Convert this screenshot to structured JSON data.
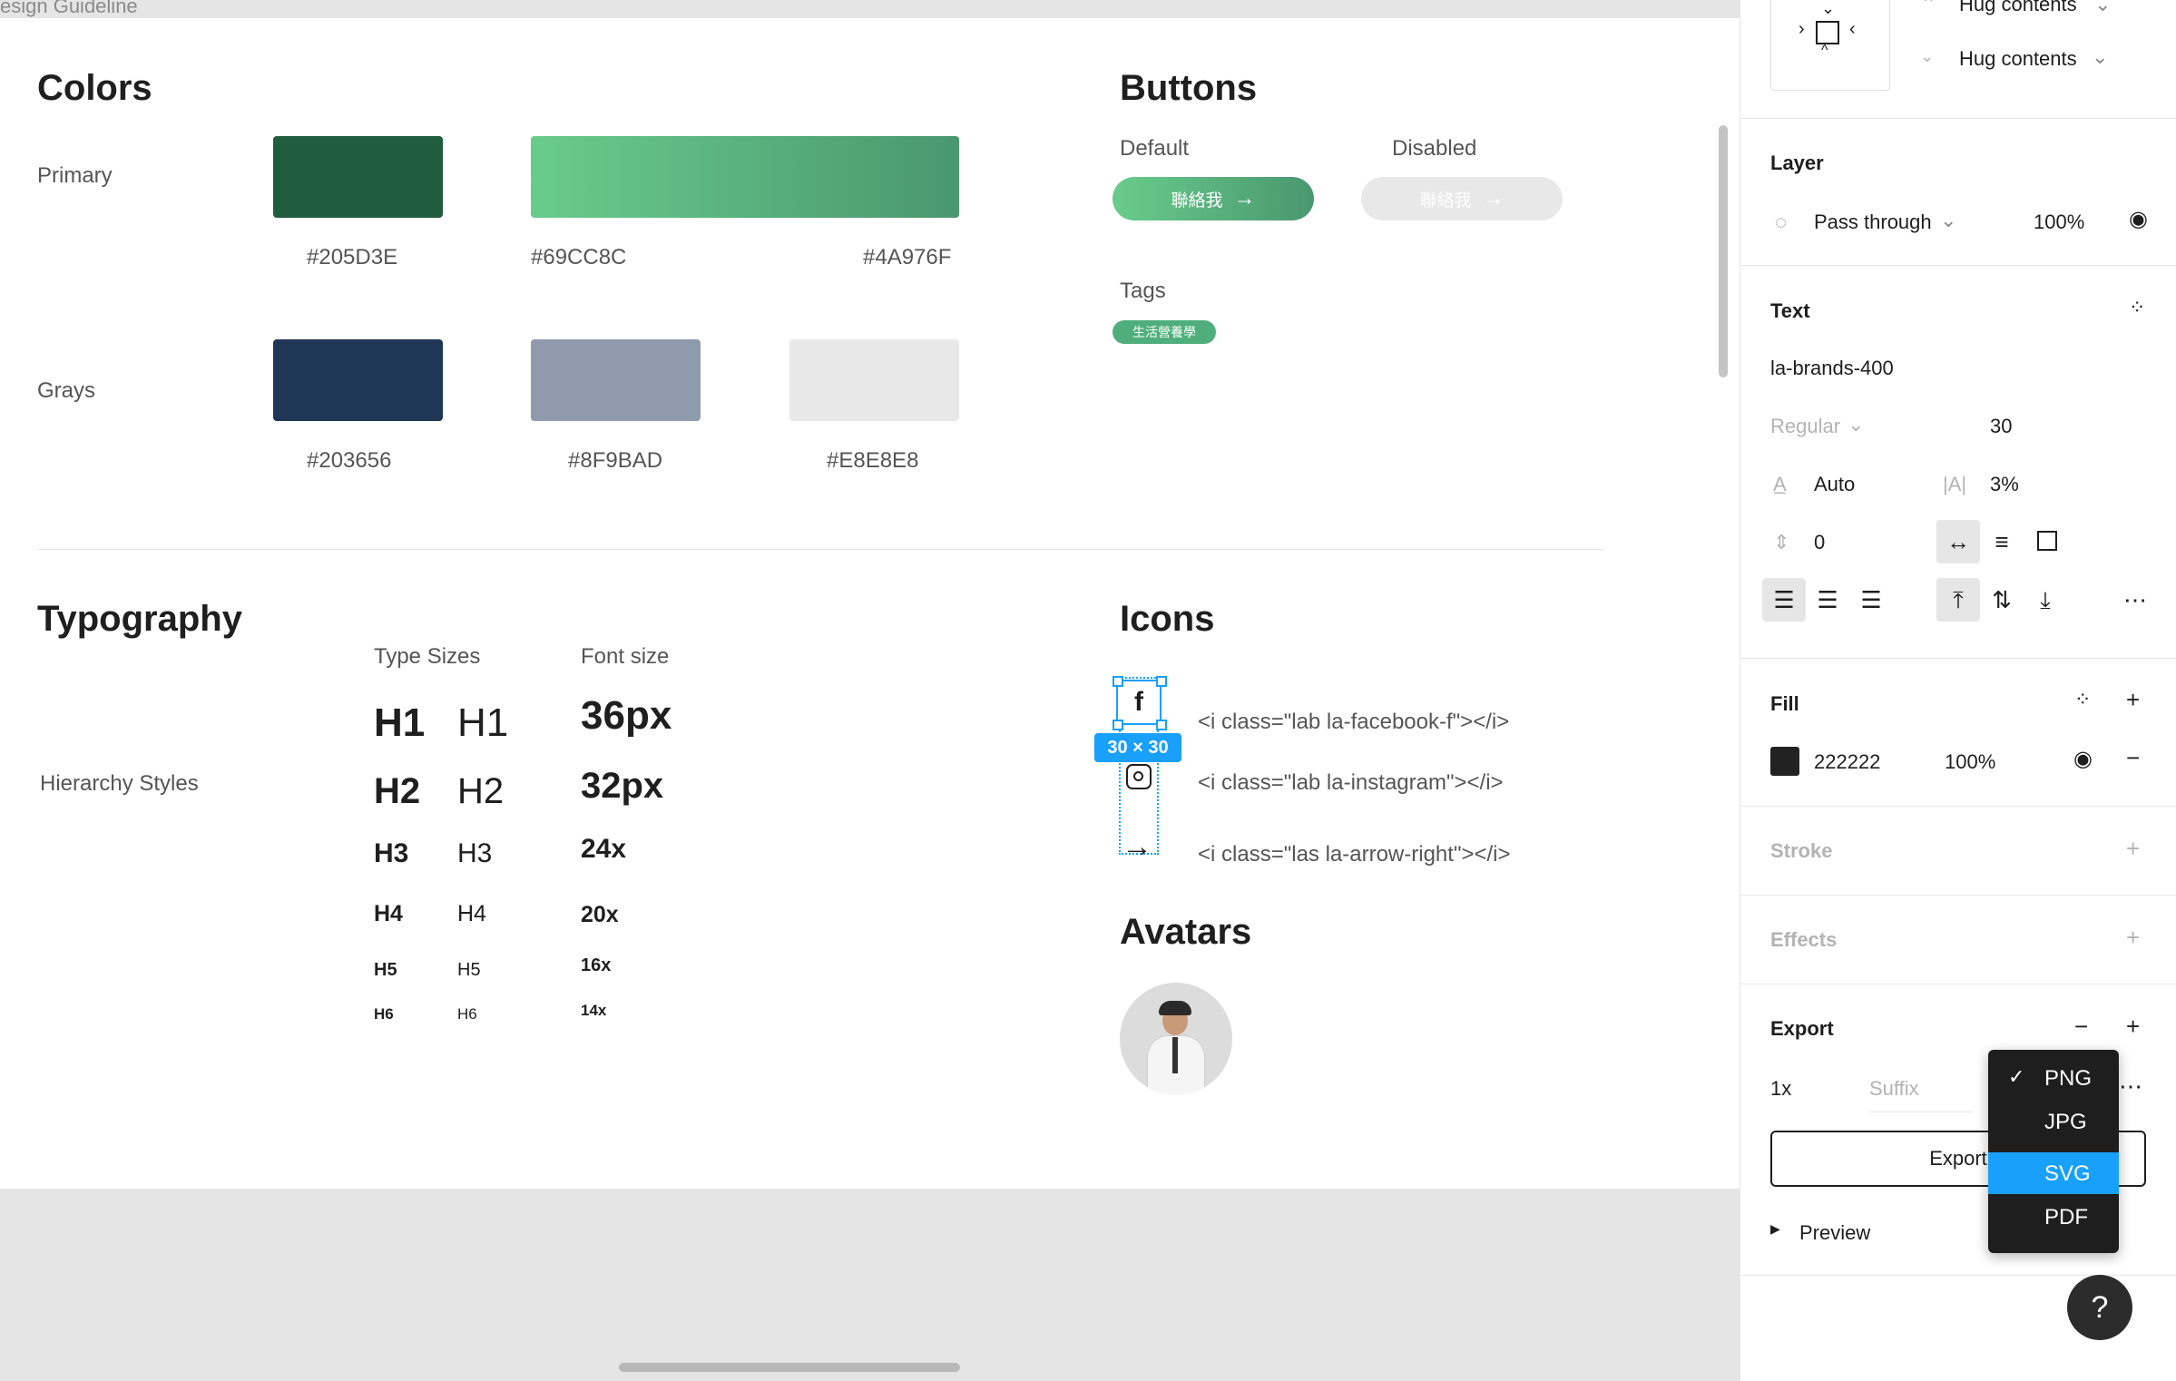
{
  "canvas": {
    "frame_title": "esign Guideline",
    "colors": {
      "title": "Colors",
      "primary_label": "Primary",
      "grays_label": "Grays",
      "primary": [
        {
          "hex": "#205D3E",
          "color": "#205D3E"
        },
        {
          "hex_start": "#69CC8C",
          "hex_end": "#4A976F",
          "gradient": [
            "#69CC8C",
            "#4A976F"
          ]
        }
      ],
      "grays": [
        {
          "hex": "#203656",
          "color": "#203656"
        },
        {
          "hex": "#8F9BAD",
          "color": "#8F9BAD"
        },
        {
          "hex": "#E8E8E8",
          "color": "#E8E8E8"
        }
      ]
    },
    "buttons": {
      "title": "Buttons",
      "default_label": "Default",
      "disabled_label": "Disabled",
      "button_text": "聯絡我",
      "arrow": "→",
      "tags_label": "Tags",
      "tag_text": "生活營養學"
    },
    "typography": {
      "title": "Typography",
      "hierarchy_label": "Hierarchy Styles",
      "type_sizes_label": "Type Sizes",
      "font_size_label": "Font size",
      "rows": [
        {
          "bold": "H1",
          "regular": "H1",
          "size": "36px"
        },
        {
          "bold": "H2",
          "regular": "H2",
          "size": "32px"
        },
        {
          "bold": "H3",
          "regular": "H3",
          "size": "24x"
        },
        {
          "bold": "H4",
          "regular": "H4",
          "size": "20x"
        },
        {
          "bold": "H5",
          "regular": "H5",
          "size": "16x"
        },
        {
          "bold": "H6",
          "regular": "H6",
          "size": "14x"
        }
      ]
    },
    "icons": {
      "title": "Icons",
      "facebook_code": "<i class=\"lab la-facebook-f\"></i>",
      "instagram_code": "<i class=\"lab la-instagram\"></i>",
      "arrow_code": "<i class=\"las la-arrow-right\"></i>",
      "selection_size": "30 × 30"
    },
    "avatars": {
      "title": "Avatars"
    }
  },
  "panel": {
    "hug_top": "Hug contents",
    "hug_bottom": "Hug contents",
    "layer": {
      "title": "Layer",
      "blend": "Pass through",
      "opacity": "100%"
    },
    "text": {
      "title": "Text",
      "font": "la-brands-400",
      "weight": "Regular",
      "size": "30",
      "line_height": "Auto",
      "letter_spacing": "3%",
      "paragraph_spacing": "0"
    },
    "fill": {
      "title": "Fill",
      "hex": "222222",
      "opacity": "100%",
      "swatch": "#222222"
    },
    "stroke": {
      "title": "Stroke"
    },
    "effects": {
      "title": "Effects"
    },
    "export": {
      "title": "Export",
      "scale": "1x",
      "suffix_placeholder": "Suffix",
      "button": "Export",
      "preview": "Preview",
      "formats": [
        "PNG",
        "JPG",
        "SVG",
        "PDF"
      ],
      "selected": "PNG",
      "highlighted": "SVG"
    },
    "help": "?"
  },
  "colors_ui": {
    "accent": "#18A0FB",
    "menu_bg": "#1E1E1E"
  }
}
